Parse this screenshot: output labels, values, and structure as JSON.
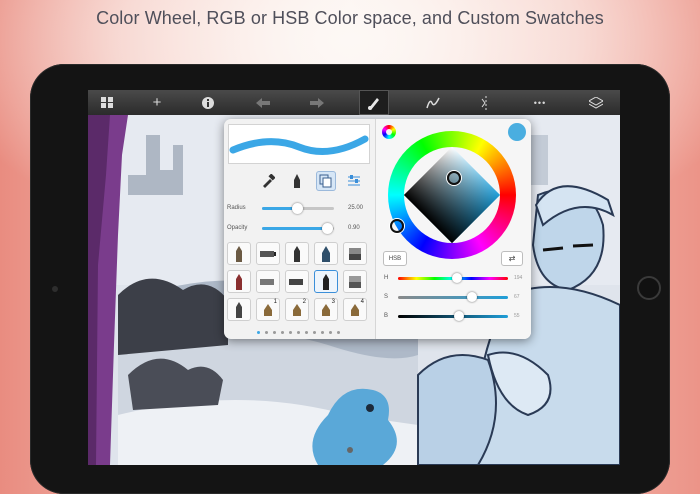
{
  "headline": "Color Wheel, RGB or HSB Color space, and Custom Swatches",
  "toolbar": {
    "items": [
      {
        "name": "gallery-icon",
        "glyph": "▦"
      },
      {
        "name": "add-icon",
        "glyph": "+"
      },
      {
        "name": "info-icon",
        "glyph": "i"
      },
      {
        "name": "undo-icon",
        "glyph": "◀"
      },
      {
        "name": "redo-icon",
        "glyph": "▶"
      },
      {
        "name": "brush-icon",
        "glyph": "✎"
      },
      {
        "name": "stroke-icon",
        "glyph": "N"
      },
      {
        "name": "symmetry-icon",
        "glyph": "⋮"
      },
      {
        "name": "more-icon",
        "glyph": "•••"
      },
      {
        "name": "layers-icon",
        "glyph": "◈"
      }
    ]
  },
  "brush_panel": {
    "radius": {
      "label": "Radius",
      "value": "25.00",
      "level": 0.48
    },
    "opacity": {
      "label": "Opacity",
      "value": "0.90",
      "level": 0.9
    },
    "slot_numbers": [
      "1",
      "2",
      "3",
      "4"
    ],
    "page_count": 11,
    "current_page": 0
  },
  "color_panel": {
    "mode_button": "HSB",
    "current_color": "#4aaee0",
    "sliders": [
      {
        "label": "H",
        "value": "194",
        "level": 0.54
      },
      {
        "label": "S",
        "value": "67",
        "level": 0.67
      },
      {
        "label": "B",
        "value": "55",
        "level": 0.55
      }
    ]
  }
}
